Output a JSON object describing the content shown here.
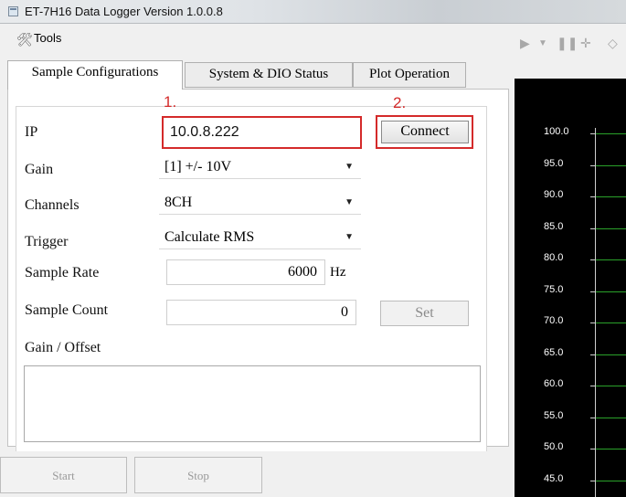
{
  "window": {
    "title": "ET-7H16 Data Logger Version 1.0.0.8"
  },
  "menu": {
    "tools_label": "Tools"
  },
  "tabs": [
    {
      "label": "Sample Configurations",
      "active": true
    },
    {
      "label": "System & DIO Status",
      "active": false
    },
    {
      "label": "Plot Operation",
      "active": false
    }
  ],
  "form": {
    "ip_label": "IP",
    "ip_value": "10.0.8.222",
    "connect_label": "Connect",
    "gain_label": "Gain",
    "gain_value": "[1] +/- 10V",
    "channels_label": "Channels",
    "channels_value": "8CH",
    "trigger_label": "Trigger",
    "trigger_value": "Calculate RMS",
    "sample_rate_label": "Sample Rate",
    "sample_rate_value": "6000",
    "sample_rate_unit": "Hz",
    "sample_count_label": "Sample Count",
    "sample_count_value": "0",
    "set_label": "Set",
    "gain_offset_label": "Gain / Offset"
  },
  "annotations": {
    "step1": "1.",
    "step2": "2."
  },
  "buttons": {
    "start_label": "Start",
    "stop_label": "Stop"
  },
  "plot": {
    "y_ticks": [
      "100.0",
      "95.0",
      "90.0",
      "85.0",
      "80.0",
      "75.0",
      "70.0",
      "65.0",
      "60.0",
      "55.0",
      "50.0",
      "45.0"
    ],
    "grid_color": "#2aa12a",
    "background": "#000000"
  },
  "colors": {
    "highlight": "#d42a2a"
  },
  "icons": {
    "tools": "tools-icon",
    "window": "app-window-icon",
    "dropdown": "chevron-down-icon"
  }
}
